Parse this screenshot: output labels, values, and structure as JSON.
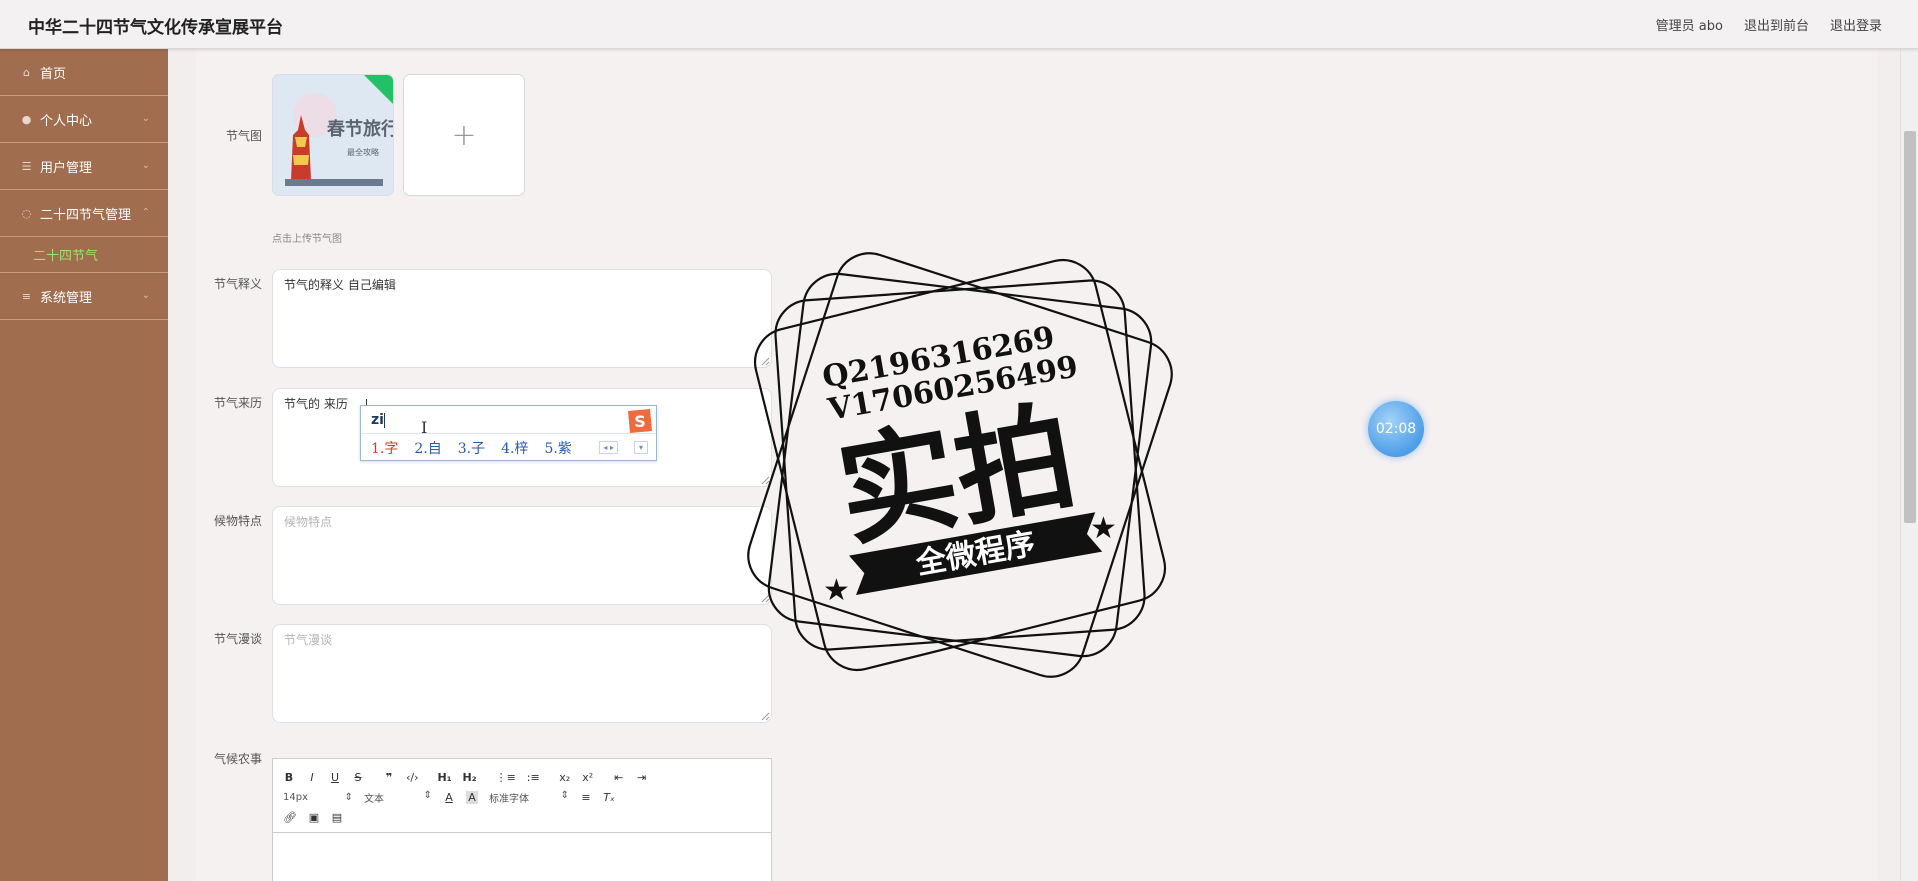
{
  "header": {
    "title": "中华二十四节气文化传承宣展平台",
    "user": "管理员 abo",
    "to_front": "退出到前台",
    "logout": "退出登录"
  },
  "sidebar": {
    "items": [
      {
        "label": "首页",
        "icon": "home-icon"
      },
      {
        "label": "个人中心",
        "icon": "user-icon"
      },
      {
        "label": "用户管理",
        "icon": "sliders-icon"
      },
      {
        "label": "二十四节气管理",
        "icon": "palette-icon"
      },
      {
        "label": "系统管理",
        "icon": "list-icon"
      }
    ],
    "subitem": "二十四节气",
    "accent_color": "#9ee36a",
    "background_color": "#a06d4f"
  },
  "form": {
    "image_label": "节气图",
    "thumbnail_text": "春节旅行",
    "thumbnail_subtext": "最全攻略",
    "upload_hint": "点击上传节气图",
    "meaning_label": "节气释义",
    "meaning_value": "节气的释义  自己编辑",
    "origin_label": "节气来历",
    "origin_value": "节气的 来历",
    "phenology_label": "候物特点",
    "phenology_placeholder": "候物特点",
    "talk_label": "节气漫谈",
    "talk_placeholder": "节气漫谈",
    "farming_label": "气候农事"
  },
  "editor": {
    "font_size": "14px",
    "paragraph": "文本",
    "font_family": "标准字体"
  },
  "ime": {
    "input": "zi",
    "candidates": [
      "1.字",
      "2.自",
      "3.子",
      "4.梓",
      "5.紫"
    ]
  },
  "timer": "02:08",
  "watermark": {
    "line1": "Q2196316269",
    "line2": "V17060256499",
    "main": "实拍",
    "banner": "全微程序"
  }
}
